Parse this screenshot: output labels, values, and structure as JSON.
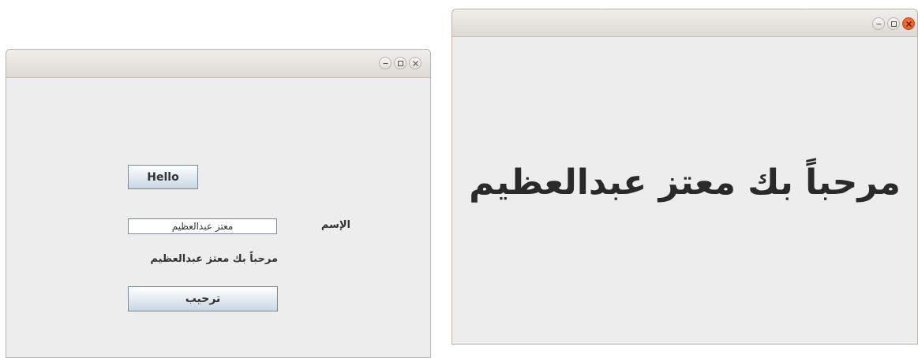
{
  "left_window": {
    "hello_button": "Hello",
    "name_label": "الإسم",
    "name_input_value": "معتز عبدالعظيم",
    "greeting_text": "مرحباً بك معتز عبدالعظيم",
    "greet_button": "ترحيب"
  },
  "right_window": {
    "greeting_text": "مرحباً بك معتز عبدالعظيم"
  },
  "window_controls": [
    "minimize-icon",
    "maximize-icon",
    "close-icon"
  ],
  "colors": {
    "window_bg": "#ededed",
    "close_active": "#e8572a"
  }
}
